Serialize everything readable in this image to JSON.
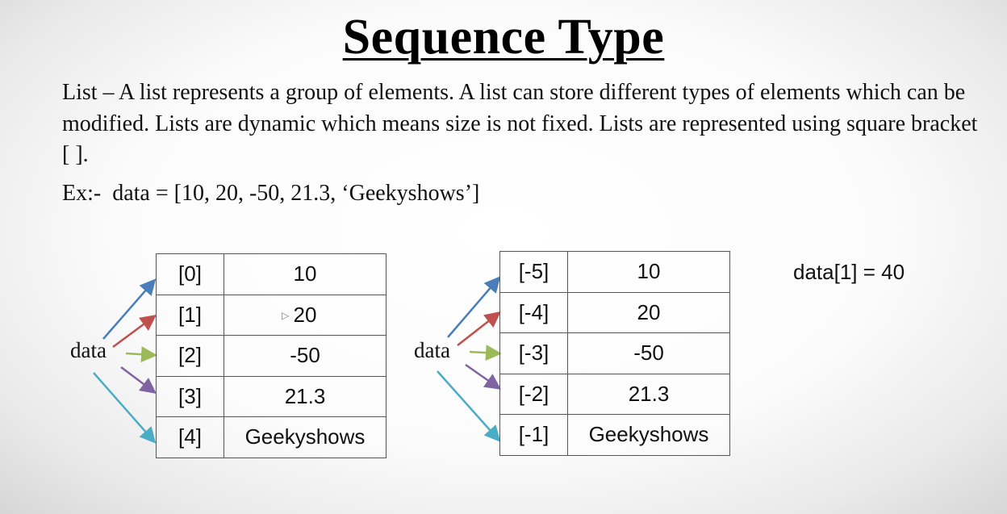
{
  "title": "Sequence Type",
  "paragraph": "List – A list represents a group of elements. A list can store different types of elements which can be modified. Lists are dynamic which means size is not fixed. Lists are represented using square bracket [ ].",
  "example": "Ex:-  data = [10, 20, -50, 21.3, ‘Geekyshows’]",
  "left_diagram": {
    "label": "data",
    "rows": [
      {
        "index": "[0]",
        "value": "10"
      },
      {
        "index": "[1]",
        "value": "20"
      },
      {
        "index": "[2]",
        "value": "-50"
      },
      {
        "index": "[3]",
        "value": "21.3"
      },
      {
        "index": "[4]",
        "value": "Geekyshows"
      }
    ]
  },
  "right_diagram": {
    "label": "data",
    "rows": [
      {
        "index": "[-5]",
        "value": "10"
      },
      {
        "index": "[-4]",
        "value": "20"
      },
      {
        "index": "[-3]",
        "value": "-50"
      },
      {
        "index": "[-2]",
        "value": "21.3"
      },
      {
        "index": "[-1]",
        "value": "Geekyshows"
      }
    ]
  },
  "assignment": "data[1] = 40",
  "arrow_colors": [
    "#4a7ebb",
    "#c0504d",
    "#9bbb59",
    "#8064a2",
    "#4bacc6"
  ]
}
